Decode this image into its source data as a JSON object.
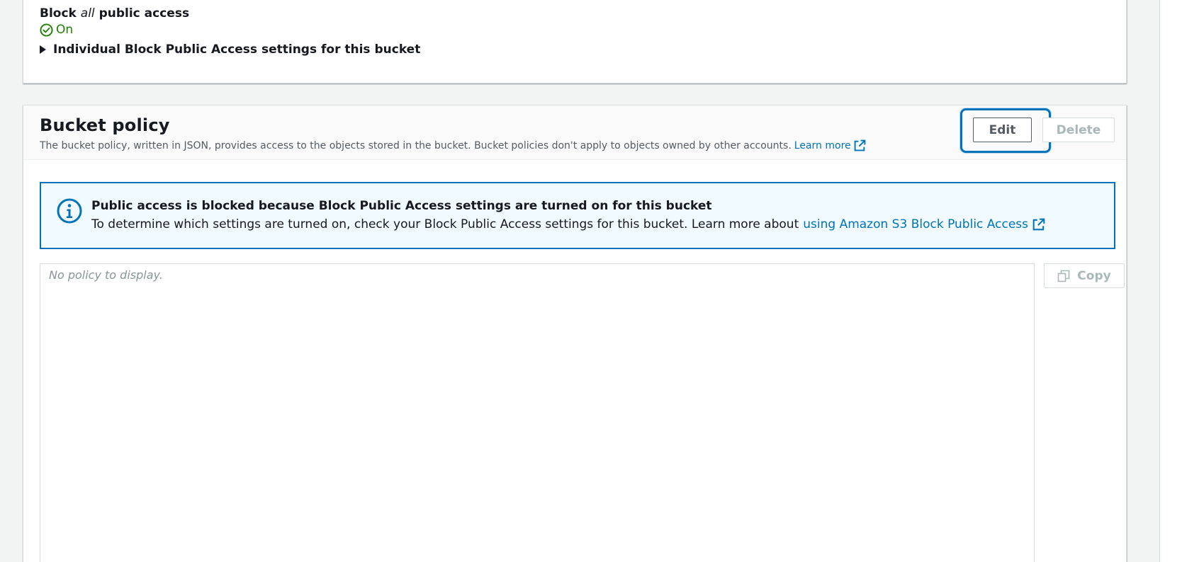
{
  "block_public_access": {
    "title_prefix": "Block",
    "title_emphasis": "all",
    "title_suffix": "public access",
    "status": "On",
    "status_icon": "check-circle-icon",
    "status_color": "#1d8102",
    "expander_label": "Individual Block Public Access settings for this bucket"
  },
  "bucket_policy": {
    "title": "Bucket policy",
    "description": "The bucket policy, written in JSON, provides access to the objects stored in the bucket. Bucket policies don't apply to objects owned by other accounts.",
    "learn_more": "Learn more",
    "edit_label": "Edit",
    "delete_label": "Delete",
    "copy_label": "Copy",
    "empty_text": "No policy to display."
  },
  "info_alert": {
    "title": "Public access is blocked because Block Public Access settings are turned on for this bucket",
    "body": "To determine which settings are turned on, check your Block Public Access settings for this bucket. Learn more about",
    "link": "using Amazon S3 Block Public Access",
    "icon": "info-icon"
  },
  "colors": {
    "link": "#0073bb",
    "success": "#1d8102",
    "info_border": "#0073bb",
    "info_background": "#f1faff",
    "disabled_text": "#aab7b8"
  }
}
